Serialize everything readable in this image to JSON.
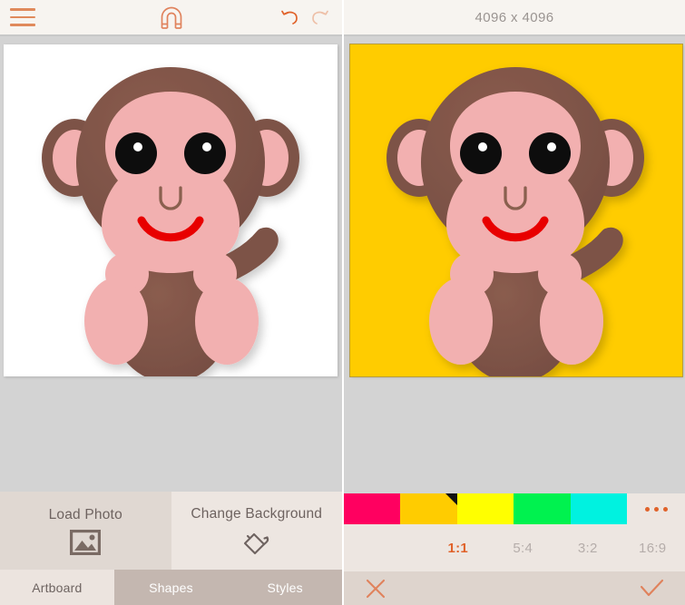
{
  "left_panel": {
    "toolbar": {
      "menu_icon": "hamburger-menu-icon",
      "snap_icon": "magnet-icon",
      "undo_icon": "undo-arrow-icon",
      "redo_icon": "redo-arrow-icon",
      "accent_color": "#e0622a",
      "disabled_color": "#eec0a8"
    },
    "actions": [
      {
        "label": "Load Photo",
        "icon": "image-icon",
        "background": "#e0d8d2"
      },
      {
        "label": "Change Background",
        "icon": "paint-bucket-icon",
        "background": "#ede6e1"
      }
    ],
    "tabs": [
      {
        "label": "Artboard",
        "active": true
      },
      {
        "label": "Shapes",
        "active": false
      },
      {
        "label": "Styles",
        "active": false
      }
    ],
    "canvas": {
      "background": "#ffffff",
      "artwork": "monkey-illustration"
    }
  },
  "right_panel": {
    "header": {
      "dimensions": "4096 x 4096"
    },
    "canvas": {
      "background": "#ffcc00",
      "artwork": "monkey-illustration"
    },
    "swatches": [
      {
        "name": "pink",
        "color": "#ff0060",
        "selected": false
      },
      {
        "name": "gold",
        "color": "#ffcc00",
        "selected": true
      },
      {
        "name": "yellow",
        "color": "#ffff00",
        "selected": false
      },
      {
        "name": "green",
        "color": "#00f24f",
        "selected": false
      },
      {
        "name": "cyan",
        "color": "#00f2e0",
        "selected": false
      }
    ],
    "more_swatches_label": "•••",
    "ratios": [
      {
        "label": "1:1",
        "active": true
      },
      {
        "label": "5:4",
        "active": false
      },
      {
        "label": "3:2",
        "active": false
      },
      {
        "label": "16:9",
        "active": false
      }
    ],
    "confirm_bar": {
      "cancel_icon": "close-x-icon",
      "accept_icon": "checkmark-icon",
      "accent_color": "#e0825c"
    }
  },
  "artwork_colors": {
    "fur_dark": "#7d5347",
    "face_pink": "#f2b0b0",
    "eye_black": "#0d0d0d",
    "eye_highlight": "#ffffff",
    "mouth_red": "#e80000",
    "nose_line": "#8a6050"
  }
}
